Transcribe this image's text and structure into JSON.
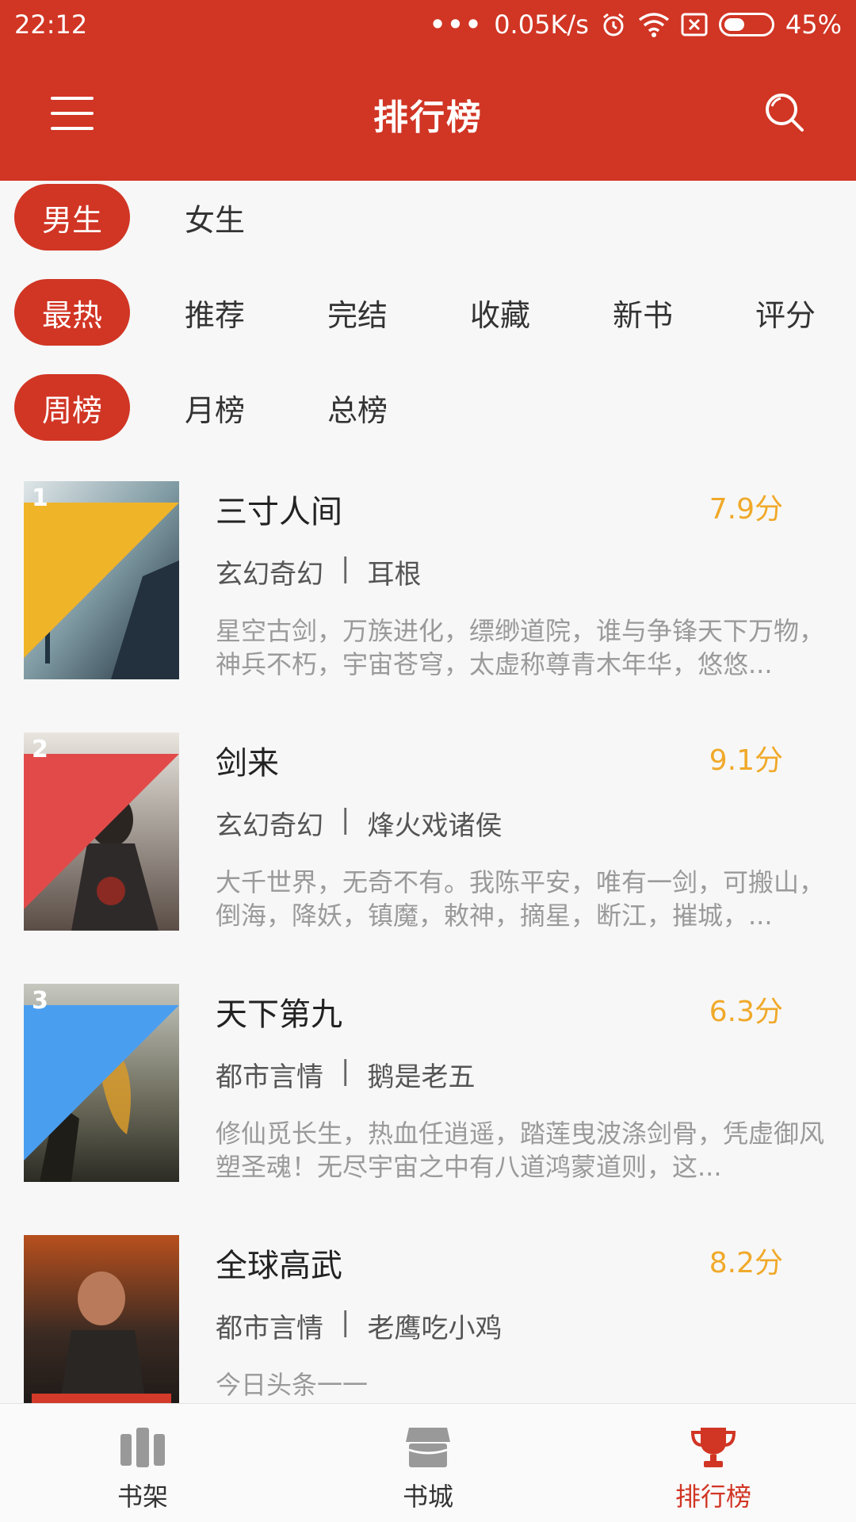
{
  "status": {
    "time": "22:12",
    "speed": "0.05K/s",
    "battery": "45%",
    "battery_level": 0.45
  },
  "appbar": {
    "title": "排行榜"
  },
  "filters": {
    "gender": [
      "男生",
      "女生"
    ],
    "type": [
      "最热",
      "推荐",
      "完结",
      "收藏",
      "新书",
      "评分"
    ],
    "period": [
      "周榜",
      "月榜",
      "总榜"
    ]
  },
  "books": [
    {
      "rank": "1",
      "title": "三寸人间",
      "score": "7.9分",
      "category": "玄幻奇幻",
      "author": "耳根",
      "desc": "星空古剑，万族进化，缥缈道院，谁与争锋天下万物，神兵不朽，宇宙苍穹，太虚称尊青木年华，悠悠..."
    },
    {
      "rank": "2",
      "title": "剑来",
      "score": "9.1分",
      "category": "玄幻奇幻",
      "author": "烽火戏诸侯",
      "desc": "大千世界，无奇不有。我陈平安，唯有一剑，可搬山，倒海，降妖，镇魔，敕神，摘星，断江，摧城，..."
    },
    {
      "rank": "3",
      "title": "天下第九",
      "score": "6.3分",
      "category": "都市言情",
      "author": "鹅是老五",
      "desc": "修仙觅长生，热血任逍遥，踏莲曳波涤剑骨，凭虚御风塑圣魂！无尽宇宙之中有八道鸿蒙道则，这..."
    },
    {
      "rank": "",
      "title": "全球高武",
      "score": "8.2分",
      "category": "都市言情",
      "author": "老鹰吃小鸡",
      "desc": "今日头条一一"
    }
  ],
  "nav": [
    {
      "label": "书架",
      "icon": "bookshelf-icon"
    },
    {
      "label": "书城",
      "icon": "store-icon"
    },
    {
      "label": "排行榜",
      "icon": "trophy-icon"
    }
  ],
  "colors": {
    "primary": "#d13524",
    "score": "#f0a92a",
    "badge1": "#f0b429",
    "badge2": "#e24a4a",
    "badge3": "#4a9ef0"
  }
}
